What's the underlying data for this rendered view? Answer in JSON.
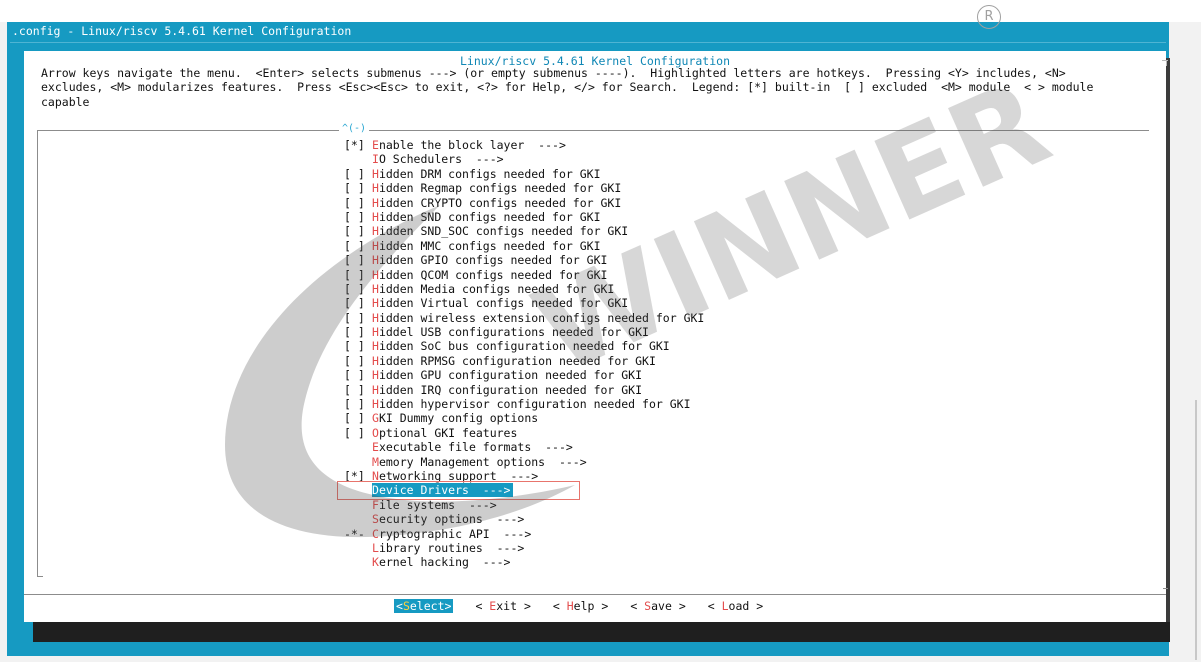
{
  "window": {
    "title_line": ".config - Linux/riscv 5.4.61 Kernel Configuration"
  },
  "dialog": {
    "title": "Linux/riscv 5.4.61 Kernel Configuration",
    "help_text": "Arrow keys navigate the menu.  <Enter> selects submenus ---> (or empty submenus ----).  Highlighted letters are hotkeys.  Pressing <Y> includes, <N>\nexcludes, <M> modularizes features.  Press <Esc><Esc> to exit, <?> for Help, </> for Search.  Legend: [*] built-in  [ ] excluded  <M> module  < > module\ncapable",
    "scroll_up_indicator": "^(-)"
  },
  "menu": {
    "items": [
      {
        "prefix": "[*]",
        "hotkey": "E",
        "rest": "nable the block layer  --->"
      },
      {
        "prefix": "",
        "hotkey": "I",
        "rest": "O Schedulers  --->"
      },
      {
        "prefix": "[ ]",
        "hotkey": "H",
        "rest": "idden DRM configs needed for GKI"
      },
      {
        "prefix": "[ ]",
        "hotkey": "H",
        "rest": "idden Regmap configs needed for GKI"
      },
      {
        "prefix": "[ ]",
        "hotkey": "H",
        "rest": "idden CRYPTO configs needed for GKI"
      },
      {
        "prefix": "[ ]",
        "hotkey": "H",
        "rest": "idden SND configs needed for GKI"
      },
      {
        "prefix": "[ ]",
        "hotkey": "H",
        "rest": "idden SND_SOC configs needed for GKI"
      },
      {
        "prefix": "[ ]",
        "hotkey": "H",
        "rest": "idden MMC configs needed for GKI"
      },
      {
        "prefix": "[ ]",
        "hotkey": "H",
        "rest": "idden GPIO configs needed for GKI"
      },
      {
        "prefix": "[ ]",
        "hotkey": "H",
        "rest": "idden QCOM configs needed for GKI"
      },
      {
        "prefix": "[ ]",
        "hotkey": "H",
        "rest": "idden Media configs needed for GKI"
      },
      {
        "prefix": "[ ]",
        "hotkey": "H",
        "rest": "idden Virtual configs needed for GKI"
      },
      {
        "prefix": "[ ]",
        "hotkey": "H",
        "rest": "idden wireless extension configs needed for GKI"
      },
      {
        "prefix": "[ ]",
        "hotkey": "H",
        "rest": "iddel USB configurations needed for GKI"
      },
      {
        "prefix": "[ ]",
        "hotkey": "H",
        "rest": "idden SoC bus configuration needed for GKI"
      },
      {
        "prefix": "[ ]",
        "hotkey": "H",
        "rest": "idden RPMSG configuration needed for GKI"
      },
      {
        "prefix": "[ ]",
        "hotkey": "H",
        "rest": "idden GPU configuration needed for GKI"
      },
      {
        "prefix": "[ ]",
        "hotkey": "H",
        "rest": "idden IRQ configuration needed for GKI"
      },
      {
        "prefix": "[ ]",
        "hotkey": "H",
        "rest": "idden hypervisor configuration needed for GKI"
      },
      {
        "prefix": "[ ]",
        "hotkey": "G",
        "rest": "KI Dummy config options"
      },
      {
        "prefix": "[ ]",
        "hotkey": "O",
        "rest": "ptional GKI features"
      },
      {
        "prefix": "",
        "hotkey": "E",
        "rest": "xecutable file formats  --->"
      },
      {
        "prefix": "",
        "hotkey": "M",
        "rest": "emory Management options  --->"
      },
      {
        "prefix": "[*]",
        "hotkey": "N",
        "rest": "etworking support  --->"
      },
      {
        "prefix": "",
        "hotkey": "D",
        "rest": "evice Drivers  --->",
        "selected": true
      },
      {
        "prefix": "",
        "hotkey": "F",
        "rest": "ile systems  --->"
      },
      {
        "prefix": "",
        "hotkey": "S",
        "rest": "ecurity options  --->"
      },
      {
        "prefix": "-*-",
        "hotkey": "C",
        "rest": "ryptographic API  --->"
      },
      {
        "prefix": "",
        "hotkey": "L",
        "rest": "ibrary routines  --->"
      },
      {
        "prefix": "",
        "hotkey": "K",
        "rest": "ernel hacking  --->"
      }
    ]
  },
  "buttons": [
    {
      "open": "<",
      "hotkey": "S",
      "rest": "elect",
      "close": ">",
      "active": true,
      "name": "select-button"
    },
    {
      "open": "< ",
      "hotkey": "E",
      "rest": "xit",
      "close": " >",
      "active": false,
      "name": "exit-button"
    },
    {
      "open": "< ",
      "hotkey": "H",
      "rest": "elp",
      "close": " >",
      "active": false,
      "name": "help-button"
    },
    {
      "open": "< ",
      "hotkey": "S",
      "rest": "ave",
      "close": " >",
      "active": false,
      "name": "save-button"
    },
    {
      "open": "< ",
      "hotkey": "L",
      "rest": "oad",
      "close": " >",
      "active": false,
      "name": "load-button"
    }
  ],
  "watermark": {
    "text": "WINNER",
    "registered_symbol": "R"
  },
  "colors": {
    "background_blue": "#169ac2",
    "hotkey_red": "#e34c4c",
    "annotation_box": "#e8746c"
  }
}
